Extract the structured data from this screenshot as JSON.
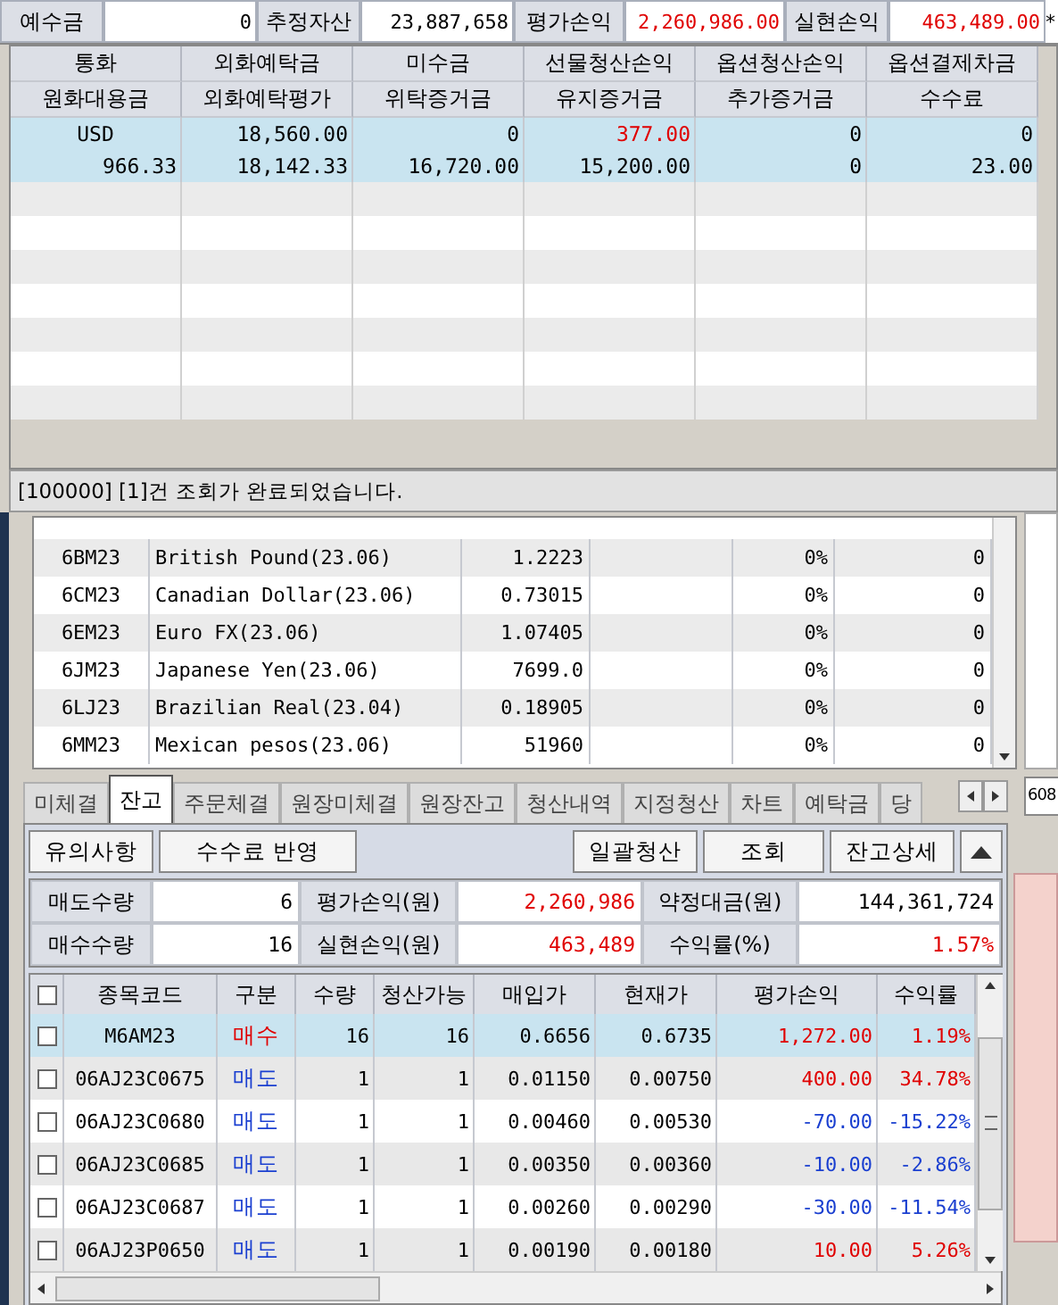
{
  "summary_bar": {
    "items": [
      {
        "label": "예수금",
        "value": "0",
        "color": "#000000"
      },
      {
        "label": "추정자산",
        "value": "23,887,658",
        "color": "#000000"
      },
      {
        "label": "평가손익",
        "value": "2,260,986.00",
        "color": "#e00000"
      },
      {
        "label": "실현손익",
        "value": "463,489.00",
        "color": "#e00000"
      }
    ],
    "overflow_mark": "*"
  },
  "deposit_table": {
    "header_row_1": [
      "통화",
      "외화예탁금",
      "미수금",
      "선물청산손익",
      "옵션청산손익",
      "옵션결제차금"
    ],
    "header_row_2": [
      "원화대용금",
      "외화예탁평가",
      "위탁증거금",
      "유지증거금",
      "추가증거금",
      "수수료"
    ],
    "rows": [
      {
        "selected": true,
        "cells": [
          {
            "text": "USD",
            "kind": "label",
            "color": "#000000"
          },
          {
            "text": "18,560.00",
            "kind": "amount",
            "color": "#000000"
          },
          {
            "text": "0",
            "kind": "amount",
            "color": "#000000"
          },
          {
            "text": "377.00",
            "kind": "amount",
            "color": "#e00000"
          },
          {
            "text": "0",
            "kind": "amount",
            "color": "#000000"
          },
          {
            "text": "0",
            "kind": "amount",
            "color": "#000000"
          }
        ]
      },
      {
        "selected": true,
        "cells": [
          {
            "text": "966.33",
            "kind": "amount",
            "color": "#000000"
          },
          {
            "text": "18,142.33",
            "kind": "amount",
            "color": "#000000"
          },
          {
            "text": "16,720.00",
            "kind": "amount",
            "color": "#000000"
          },
          {
            "text": "15,200.00",
            "kind": "amount",
            "color": "#000000"
          },
          {
            "text": "0",
            "kind": "amount",
            "color": "#000000"
          },
          {
            "text": "23.00",
            "kind": "amount",
            "color": "#000000"
          }
        ]
      }
    ],
    "status": "[100000] [1]건 조회가 완료되었습니다."
  },
  "futures_list": {
    "rows": [
      {
        "column_1": "6BM23",
        "column_2": "British Pound(23.06)",
        "column_3": "1.2223",
        "column_5": "0%",
        "column_6": "0"
      },
      {
        "column_1": "6CM23",
        "column_2": "Canadian Dollar(23.06)",
        "column_3": "0.73015",
        "column_5": "0%",
        "column_6": "0"
      },
      {
        "column_1": "6EM23",
        "column_2": "Euro FX(23.06)",
        "column_3": "1.07405",
        "column_5": "0%",
        "column_6": "0"
      },
      {
        "column_1": "6JM23",
        "column_2": "Japanese Yen(23.06)",
        "column_3": "7699.0",
        "column_5": "0%",
        "column_6": "0"
      },
      {
        "column_1": "6LJ23",
        "column_2": "Brazilian Real(23.04)",
        "column_3": "0.18905",
        "column_5": "0%",
        "column_6": "0"
      },
      {
        "column_1": "6MM23",
        "column_2": "Mexican pesos(23.06)",
        "column_3": "51960",
        "column_5": "0%",
        "column_6": "0"
      }
    ]
  },
  "tabs": [
    {
      "label": "미체결",
      "selected": false
    },
    {
      "label": "잔고",
      "selected": true
    },
    {
      "label": "주문체결",
      "selected": false
    },
    {
      "label": "원장미체결",
      "selected": false
    },
    {
      "label": "원장잔고",
      "selected": false
    },
    {
      "label": "청산내역",
      "selected": false
    },
    {
      "label": "지정청산",
      "selected": false
    },
    {
      "label": "차트",
      "selected": false
    },
    {
      "label": "예탁금",
      "selected": false
    },
    {
      "label": "당",
      "selected": false
    }
  ],
  "side_field": "608",
  "buttons_left": [
    "유의사항",
    "수수료 반영"
  ],
  "buttons_right": [
    "일괄청산",
    "조회",
    "잔고상세"
  ],
  "balance_summary": [
    {
      "label": "매도수량",
      "value": "6",
      "color": "#000000"
    },
    {
      "label": "평가손익(원)",
      "value": "2,260,986",
      "color": "#e00000"
    },
    {
      "label": "약정대금(원)",
      "value": "144,361,724",
      "color": "#000000"
    },
    {
      "label": "매수수량",
      "value": "16",
      "color": "#000000"
    },
    {
      "label": "실현손익(원)",
      "value": "463,489",
      "color": "#e00000"
    },
    {
      "label": "수익률(%)",
      "value": "1.57%",
      "color": "#e00000"
    }
  ],
  "positions": {
    "select_all": {
      "checked": false
    },
    "columns": [
      "종목코드",
      "구분",
      "수량",
      "청산가능",
      "매입가",
      "현재가",
      "평가손익",
      "수익률"
    ],
    "rows": [
      {
        "selected": true,
        "checked": false,
        "code": "M6AM23",
        "side": "매수",
        "kind": "buy",
        "qty": "16",
        "closable": "16",
        "buy_price": "0.6656",
        "current_price": "0.6735",
        "pnl": "1,272.00",
        "rate": "1.19%",
        "color": "#e00000"
      },
      {
        "selected": false,
        "checked": false,
        "code": "06AJ23C0675",
        "side": "매도",
        "kind": "sell",
        "qty": "1",
        "closable": "1",
        "buy_price": "0.01150",
        "current_price": "0.00750",
        "pnl": "400.00",
        "rate": "34.78%",
        "color": "#e00000"
      },
      {
        "selected": false,
        "checked": false,
        "code": "06AJ23C0680",
        "side": "매도",
        "kind": "sell",
        "qty": "1",
        "closable": "1",
        "buy_price": "0.00460",
        "current_price": "0.00530",
        "pnl": "-70.00",
        "rate": "-15.22%",
        "color": "#1a3fd0"
      },
      {
        "selected": false,
        "checked": false,
        "code": "06AJ23C0685",
        "side": "매도",
        "kind": "sell",
        "qty": "1",
        "closable": "1",
        "buy_price": "0.00350",
        "current_price": "0.00360",
        "pnl": "-10.00",
        "rate": "-2.86%",
        "color": "#1a3fd0"
      },
      {
        "selected": false,
        "checked": false,
        "code": "06AJ23C0687",
        "side": "매도",
        "kind": "sell",
        "qty": "1",
        "closable": "1",
        "buy_price": "0.00260",
        "current_price": "0.00290",
        "pnl": "-30.00",
        "rate": "-11.54%",
        "color": "#1a3fd0"
      },
      {
        "selected": false,
        "checked": false,
        "code": "06AJ23P0650",
        "side": "매도",
        "kind": "sell",
        "qty": "1",
        "closable": "1",
        "buy_price": "0.00190",
        "current_price": "0.00180",
        "pnl": "10.00",
        "rate": "5.26%",
        "color": "#e00000"
      }
    ]
  }
}
